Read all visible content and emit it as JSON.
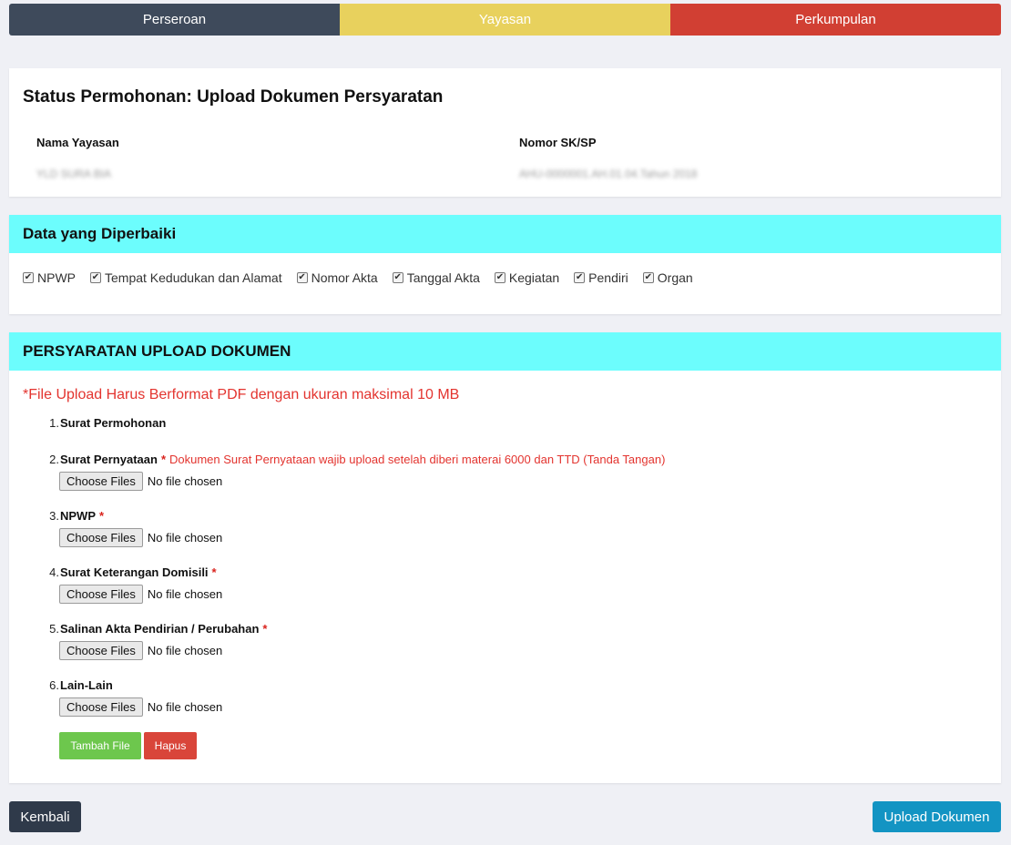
{
  "tabs": [
    {
      "label": "Perseroan"
    },
    {
      "label": "Yayasan"
    },
    {
      "label": "Perkumpulan"
    }
  ],
  "colors": {
    "tab_perseroan": "#3e4a5b",
    "tab_yayasan": "#e8d15d",
    "tab_perkumpulan": "#d13f33",
    "section_header": "#6cfdfd",
    "warning_text": "#e3342f",
    "btn_add": "#6dc74d",
    "btn_delete": "#d9453a",
    "btn_back": "#2f3a4a",
    "btn_upload": "#1394c3"
  },
  "status": {
    "title": "Status Permohonan: Upload Dokumen Persyaratan",
    "nama_label": "Nama Yayasan",
    "nama_value": "YLD SURA BIA",
    "nomor_label": "Nomor SK/SP",
    "nomor_value": "AHU-0000001.AH.01.04.Tahun 2018"
  },
  "diperbaiki": {
    "header": "Data yang Diperbaiki",
    "items": [
      {
        "label": "NPWP",
        "checked": true
      },
      {
        "label": "Tempat Kedudukan dan Alamat",
        "checked": true
      },
      {
        "label": "Nomor Akta",
        "checked": true
      },
      {
        "label": "Tanggal Akta",
        "checked": true
      },
      {
        "label": "Kegiatan",
        "checked": true
      },
      {
        "label": "Pendiri",
        "checked": true
      },
      {
        "label": "Organ",
        "checked": true
      }
    ],
    "check_glyph": "✔"
  },
  "persyaratan": {
    "header": "PERSYARATAN UPLOAD DOKUMEN",
    "note": "*File Upload Harus Berformat PDF dengan ukuran maksimal 10 MB",
    "star": "*",
    "choose_label": "Choose Files",
    "no_file": "No file chosen",
    "items": [
      {
        "num": "1.",
        "name": "Surat Permohonan"
      },
      {
        "num": "2.",
        "name": "Surat Pernyataan",
        "desc": "Dokumen Surat Pernyataan wajib upload setelah diberi materai 6000 dan TTD (Tanda Tangan)"
      },
      {
        "num": "3.",
        "name": "NPWP"
      },
      {
        "num": "4.",
        "name": "Surat Keterangan Domisili"
      },
      {
        "num": "5.",
        "name": "Salinan Akta Pendirian / Perubahan"
      },
      {
        "num": "6.",
        "name": "Lain-Lain"
      }
    ],
    "add_label": "Tambah File",
    "delete_label": "Hapus"
  },
  "footer": {
    "back_label": "Kembali",
    "upload_label": "Upload Dokumen"
  }
}
